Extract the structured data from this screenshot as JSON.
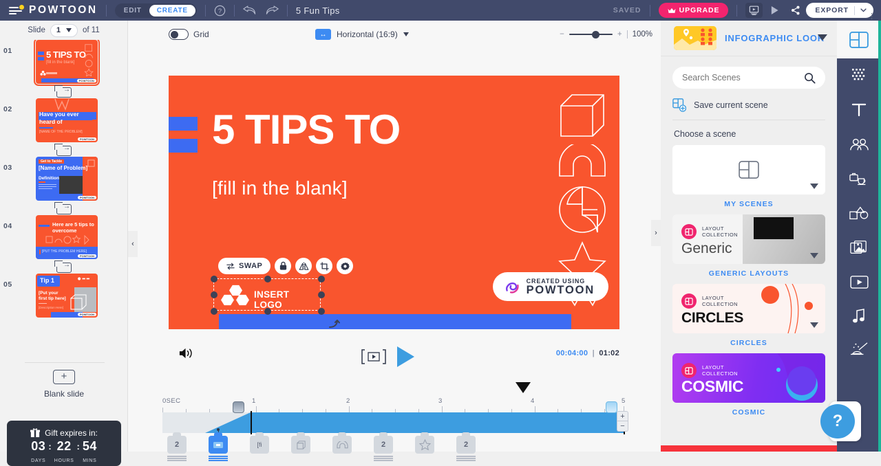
{
  "topbar": {
    "brand": "POWTOON",
    "mode_tabs": [
      {
        "label": "EDIT",
        "active": false
      },
      {
        "label": "CREATE",
        "active": true
      }
    ],
    "help_icon": "question-circle-icon",
    "undo_icon": "undo-arrow-icon",
    "redo_icon": "redo-arrow-icon",
    "project_title": "5 Fun Tips",
    "saved_status": "SAVED",
    "upgrade_label": "UPGRADE",
    "upgrade_icon": "crown-icon",
    "upgrade_color": "#f3246e",
    "present_icon": "presentation-icon",
    "play_icon": "play-triangle-icon",
    "share_icon": "share-nodes-icon",
    "export_label": "EXPORT",
    "export_caret_icon": "chevron-down-icon"
  },
  "sidebar": {
    "slide_word": "Slide",
    "current_slide": "1",
    "of_label": "of 11",
    "slides": [
      {
        "num": "01",
        "title": "5 TIPS TO",
        "subtitle": "[fill in the blank]",
        "selected": true
      },
      {
        "num": "02",
        "title": "Have you ever heard of",
        "subtitle": "[NAME OF THE PROBLEM]",
        "selected": false
      },
      {
        "num": "03",
        "title": "[Name of Problem]",
        "subtitle": "Definition",
        "selected": false
      },
      {
        "num": "04",
        "title": "Here are  5 tips to overcome",
        "subtitle": "[PUT THE PROBLEM HERE]",
        "selected": false
      },
      {
        "num": "05",
        "title": "Tip 1",
        "subtitle": "[Put your first tip here]",
        "selected": false
      }
    ],
    "add_slide_icon": "duplicate-slide-icon",
    "blank_slide_label": "Blank slide",
    "blank_plus_icon": "plus-icon",
    "gift": {
      "icon": "gift-icon",
      "label": "Gift expires in:",
      "days_value": "03",
      "days_label": "DAYS",
      "hours_value": "22",
      "hours_label": "HOURS",
      "mins_value": "54",
      "mins_label": "MINS"
    }
  },
  "canvas_tools": {
    "grid_label": "Grid",
    "grid_on": false,
    "ratio_icon": "horizontal-arrows-icon",
    "ratio_label": "Horizontal (16:9)",
    "ratio_caret_icon": "caret-down-icon",
    "zoom_minus": "−",
    "zoom_plus": "+",
    "zoom_value": "100%"
  },
  "slide": {
    "bg_color": "#f9552e",
    "accent_color": "#3d6bf2",
    "title": "5 TIPS TO",
    "subtitle": "[fill in the blank]",
    "decorations": [
      "cube-outline",
      "arch-outline",
      "circle-bolt-outline",
      "star-outline"
    ],
    "watermark": {
      "small": "CREATED USING",
      "big": "POWTOON"
    }
  },
  "element_toolbar": {
    "swap_label": "SWAP",
    "swap_icon": "swap-arrows-icon",
    "lock_icon": "lock-icon",
    "flip_icon": "flip-horizontal-icon",
    "crop_icon": "crop-icon",
    "settings_icon": "gear-icon"
  },
  "selection": {
    "label": "INSERT LOGO",
    "logo_icon": "hex-cluster-icon",
    "rotate_icon": "rotate-handle-icon"
  },
  "player": {
    "volume_icon": "speaker-waves-icon",
    "step_icon": "step-frame-icon",
    "play_icon": "play-triangle-icon",
    "current_time": "00:04:00",
    "separator": "|",
    "total_time": "01:02"
  },
  "timeline": {
    "zero_label": "0SEC",
    "ticks": [
      "1",
      "2",
      "3",
      "4",
      "5"
    ],
    "zoom_in": "+",
    "zoom_out": "−",
    "objects": [
      {
        "label": "2",
        "kind": "text",
        "active": false
      },
      {
        "label": "",
        "kind": "image",
        "active": true
      },
      {
        "label": "[fi",
        "kind": "text",
        "active": false
      },
      {
        "label": "",
        "kind": "cube",
        "active": false
      },
      {
        "label": "",
        "kind": "arch",
        "active": false
      },
      {
        "label": "2",
        "kind": "text",
        "active": false
      },
      {
        "label": "",
        "kind": "star",
        "active": false
      },
      {
        "label": "2",
        "kind": "text",
        "active": false
      }
    ]
  },
  "right_panel": {
    "look_title": "INFOGRAPHIC LOOK",
    "look_thumb_icon": "infographic-thumbnail",
    "look_caret_icon": "caret-down-icon",
    "search_placeholder": "Search Scenes",
    "search_value": "",
    "search_icon": "magnifier-icon",
    "save_scene_label": "Save current scene",
    "save_scene_icon": "save-layout-icon",
    "choose_label": "Choose a scene",
    "scenes": [
      {
        "label": "MY SCENES",
        "kind": "my-scenes",
        "collection_tag": "",
        "name": ""
      },
      {
        "label": "GENERIC LAYOUTS",
        "kind": "generic",
        "collection_tag": "LAYOUT\nCOLLECTION",
        "name": "Generic"
      },
      {
        "label": "CIRCLES",
        "kind": "circles",
        "collection_tag": "LAYOUT\nCOLLECTION",
        "name": "CIRCLES"
      },
      {
        "label": "COSMIC",
        "kind": "cosmic",
        "collection_tag": "LAYOUT\nCOLLECTION",
        "name": "COSMIC"
      }
    ]
  },
  "rail": {
    "items": [
      {
        "icon": "layout-grid-icon",
        "active": true
      },
      {
        "icon": "background-texture-icon",
        "active": false
      },
      {
        "icon": "text-tool-icon",
        "active": false
      },
      {
        "icon": "characters-icon",
        "active": false
      },
      {
        "icon": "props-icon",
        "active": false
      },
      {
        "icon": "shapes-icon",
        "active": false
      },
      {
        "icon": "images-icon",
        "active": false
      },
      {
        "icon": "video-icon",
        "active": false
      },
      {
        "icon": "music-icon",
        "active": false
      },
      {
        "icon": "magic-icon",
        "active": false
      }
    ]
  },
  "help": {
    "icon": "question-mark-icon",
    "menu_icon": "vertical-dots-icon"
  },
  "collapse": {
    "left_icon": "chevron-left-icon",
    "right_icon": "chevron-right-icon"
  }
}
